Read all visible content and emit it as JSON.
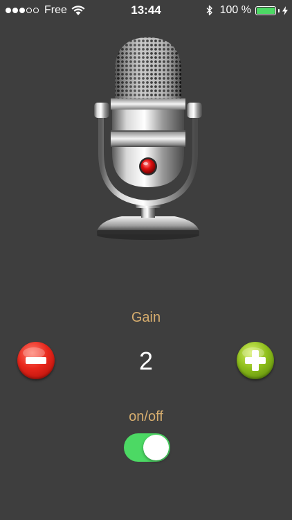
{
  "status_bar": {
    "carrier": "Free",
    "signal_bars_filled": 3,
    "signal_bars_total": 5,
    "time": "13:44",
    "battery_percent_text": "100 %",
    "battery_level": 1.0,
    "charging": true,
    "icons": [
      "wifi-icon",
      "bluetooth-icon",
      "battery-icon",
      "charging-bolt-icon"
    ]
  },
  "microphone": {
    "icon": "microphone-icon",
    "record_light_color": "#e01010"
  },
  "gain": {
    "label": "Gain",
    "value": "2",
    "decrease_icon": "minus-icon",
    "increase_icon": "plus-icon"
  },
  "power": {
    "label": "on/off",
    "is_on": true
  },
  "colors": {
    "background": "#3e3e3e",
    "label_color": "#d6ad6e",
    "toggle_on": "#4cd964",
    "minus_button": "#e8261b",
    "plus_button": "#8fbf1c"
  }
}
